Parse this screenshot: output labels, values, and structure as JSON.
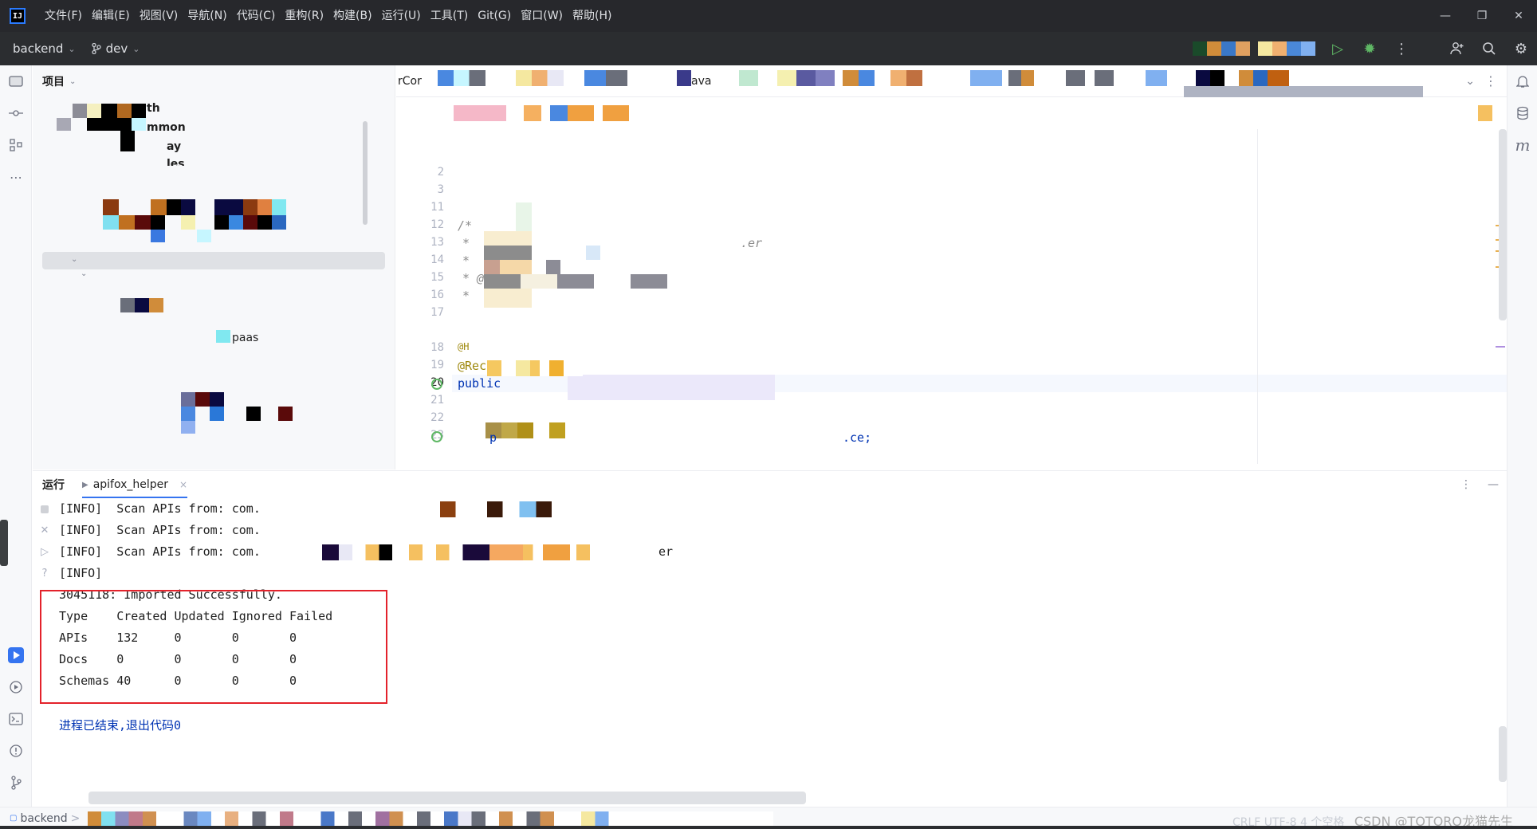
{
  "title_bar": {
    "logo_text": "IJ",
    "menu": [
      "文件(F)",
      "编辑(E)",
      "视图(V)",
      "导航(N)",
      "代码(C)",
      "重构(R)",
      "构建(B)",
      "运行(U)",
      "工具(T)",
      "Git(G)",
      "窗口(W)",
      "帮助(H)"
    ],
    "win_min": "—",
    "win_restore": "❐",
    "win_close": "✕"
  },
  "toolbar": {
    "project_name": "backend",
    "branch": "dev",
    "chevron": "⌄",
    "branch_icon": "branch-icon",
    "run_icon": "▷",
    "debug_icon": "✹",
    "more_icon": "⋮",
    "add_user_icon": "⍝",
    "search_icon": "⌕",
    "settings_icon": "⚙"
  },
  "project_panel": {
    "header": "项目",
    "visible_fragments": [
      "th",
      "mmon",
      "ay",
      "les",
      "paas"
    ]
  },
  "editor": {
    "tab_fragments": [
      "rCor",
      "ava"
    ],
    "line_numbers": [
      "2",
      "3",
      "11",
      "12",
      "13",
      "14",
      "15",
      "16",
      "17",
      "18",
      "19",
      "20",
      "21",
      "22",
      "23"
    ],
    "current_line": "20",
    "code_fragments": {
      "l12": "/*",
      "l13": "*",
      "l13_tail": ".er",
      "l14": "*",
      "l15": "* @",
      "l16": "*",
      "l18": "@H",
      "l19": "@Rec",
      "l20": "public",
      "l23": "p",
      "l23_tail": ".ce;"
    }
  },
  "run_panel": {
    "title": "运行",
    "tab_label": "apifox_helper",
    "tab_close": "×",
    "more_icon": "⋮",
    "minimize_icon": "—",
    "console_lines": [
      "[INFO]  Scan APIs from: com.",
      "[INFO]  Scan APIs from: com.",
      "[INFO]  Scan APIs from: com.",
      "[INFO]",
      "3045118: Imported Successfully.",
      "Type    Created Updated Ignored Failed",
      "APIs    132     0       0       0",
      "Docs    0       0       0       0",
      "Schemas 40      0       0       0",
      "",
      "进程已结束,退出代码0"
    ],
    "line3_tail": "er"
  },
  "status_bar": {
    "project": "backend",
    "separator": ">",
    "right_text": "CSDN @TOTORO龙猫先生",
    "encoding": "CRLF  UTF-8  4 个空格"
  },
  "colors": {
    "accent": "#3574f0",
    "highlight_box": "#e3222b",
    "titlebar": "#27282c",
    "toolbar": "#2b2d30"
  }
}
